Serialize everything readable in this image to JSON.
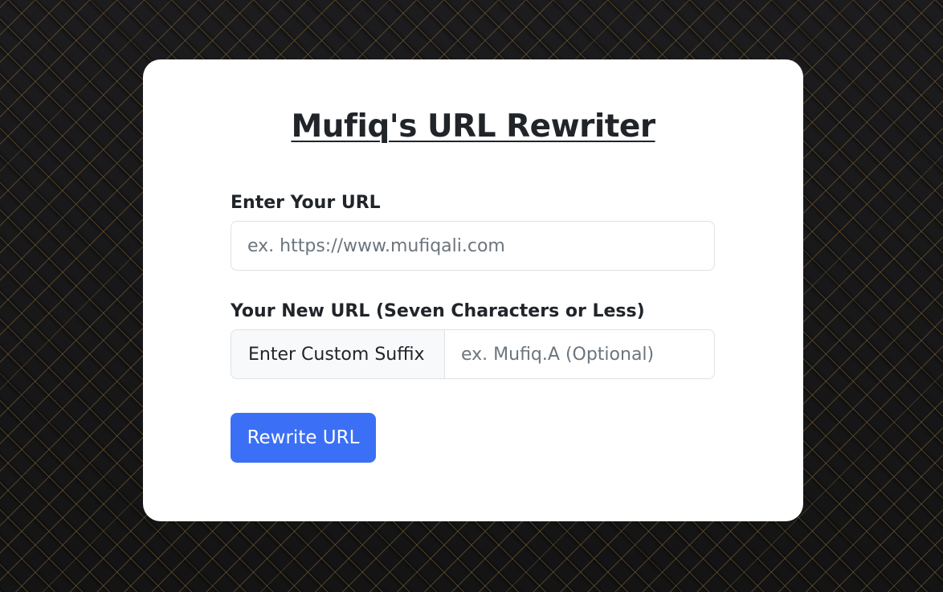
{
  "app": {
    "title": "Mufiq's URL Rewriter"
  },
  "form": {
    "url_label": "Enter Your URL",
    "url_placeholder": "ex. https://www.mufiqali.com",
    "url_value": "",
    "new_url_label": "Your New URL (Seven Characters or Less)",
    "suffix_addon": "Enter Custom Suffix",
    "suffix_placeholder": "ex. Mufiq.A (Optional)",
    "suffix_value": "",
    "submit_label": "Rewrite URL"
  },
  "colors": {
    "button": "#3b6ff5",
    "card": "#ffffff",
    "background": "#1a1a1b"
  }
}
